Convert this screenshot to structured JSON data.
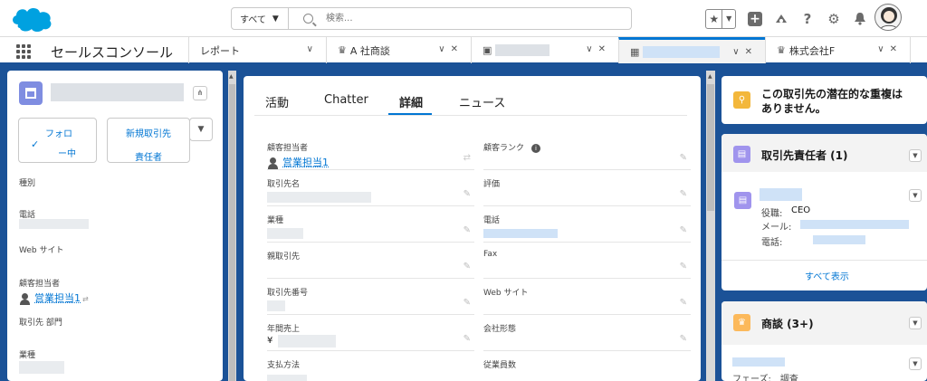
{
  "header": {
    "search_scope": "すべて",
    "search_placeholder": "検索..."
  },
  "nav": {
    "app_name": "セールスコンソール",
    "tabs": [
      {
        "label": "レポート"
      },
      {
        "label": "A 社商談"
      },
      {
        "label": ""
      },
      {
        "label": ""
      },
      {
        "label": "株式会社F"
      }
    ]
  },
  "left_panel": {
    "follow_line1": "フォロ",
    "follow_line2": "ー中",
    "new_contact_line1": "新規取引先",
    "new_contact_line2": "責任者",
    "fields": [
      {
        "label": "種別"
      },
      {
        "label": "電話"
      },
      {
        "label": "Web サイト"
      },
      {
        "label": "顧客担当者",
        "value": "営業担当1"
      },
      {
        "label": "取引先 部門"
      },
      {
        "label": "業種"
      }
    ]
  },
  "main_panel": {
    "tabs": [
      "活動",
      "Chatter",
      "詳細",
      "ニュース"
    ],
    "selected_tab": "詳細",
    "left_fields": [
      {
        "label": "顧客担当者",
        "value": "営業担当1"
      },
      {
        "label": "取引先名"
      },
      {
        "label": "業種"
      },
      {
        "label": "親取引先"
      },
      {
        "label": "取引先番号"
      },
      {
        "label": "年間売上",
        "value": "¥"
      },
      {
        "label": "支払方法"
      }
    ],
    "right_fields": [
      {
        "label": "顧客ランク"
      },
      {
        "label": "評価"
      },
      {
        "label": "電話"
      },
      {
        "label": "Fax"
      },
      {
        "label": "Web サイト"
      },
      {
        "label": "会社形態"
      },
      {
        "label": "従業員数"
      }
    ]
  },
  "right_panel": {
    "duplicate_line1": "この取引先の潜在的な重複は",
    "duplicate_line2": "ありません。",
    "contacts_title": "取引先責任者 (1)",
    "contact_role_label": "役職:",
    "contact_role_value": "CEO",
    "contact_email_label": "メール:",
    "contact_phone_label": "電話:",
    "view_all": "すべて表示",
    "opps_title": "商談 (3+)",
    "opp_phase": "フェーズ:　調査"
  },
  "colors": {
    "brand_blue": "#1b5297",
    "link_blue": "#0176d3",
    "account_icon": "#7f8de1",
    "duplicate_icon": "#f3b73b",
    "contact_icon": "#a094ed",
    "opportunity_icon": "#fcb95b"
  }
}
